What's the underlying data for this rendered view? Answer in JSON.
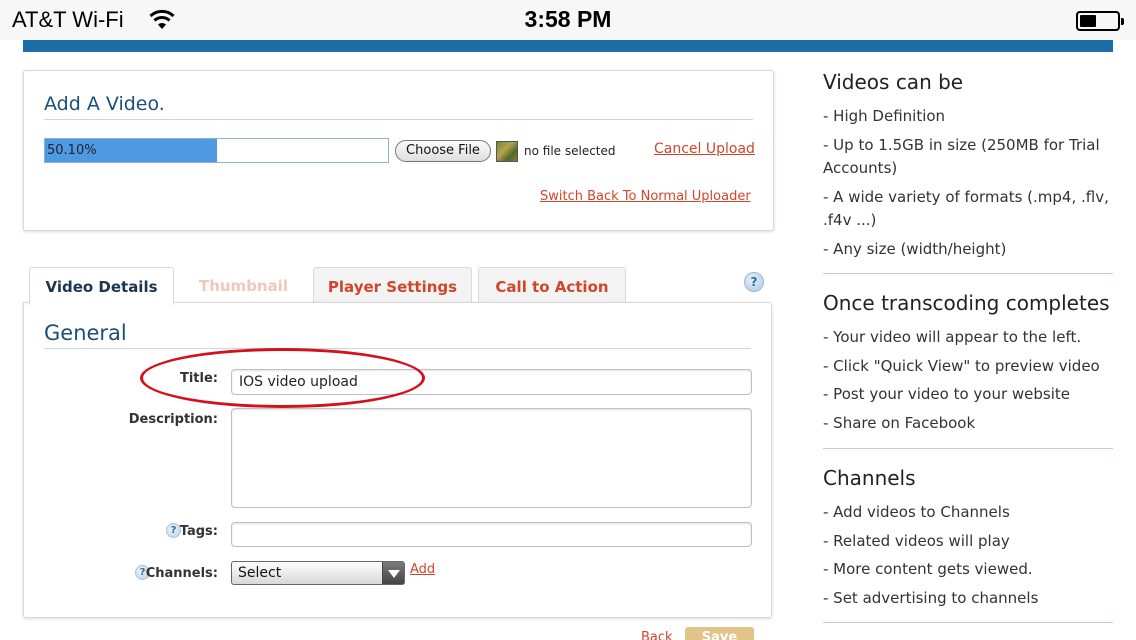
{
  "status_bar": {
    "carrier": "AT&T Wi-Fi",
    "time": "3:58 PM"
  },
  "upload": {
    "title": "Add A Video.",
    "progress": 0.501,
    "progress_text": "50.10%",
    "choose_file_label": "Choose File",
    "file_status": "no file selected",
    "cancel_label": "Cancel Upload",
    "switch_label": "Switch Back To Normal Uploader"
  },
  "tabs": {
    "active": "Video Details",
    "items": [
      {
        "label": "Video Details"
      },
      {
        "label": "Thumbnail"
      },
      {
        "label": "Player Settings"
      },
      {
        "label": "Call to Action"
      }
    ],
    "help": "?"
  },
  "details": {
    "section_title": "General",
    "title_label": "Title:",
    "title_value": "IOS video upload",
    "description_label": "Description:",
    "description_value": "",
    "tags_label": "Tags:",
    "tags_value": "",
    "channels_label": "Channels:",
    "channels_selected": "Select",
    "add_label": "Add",
    "help": "?"
  },
  "footer": {
    "back_label": "Back",
    "save_label": "Save"
  },
  "sidebar": {
    "sections": [
      {
        "heading": "Videos can be",
        "items": [
          "- High Definition",
          "- Up to 1.5GB in size (250MB for Trial Accounts)",
          "- A wide variety of formats (.mp4, .flv, .f4v ...)",
          "- Any size (width/height)"
        ]
      },
      {
        "heading": "Once transcoding completes",
        "items": [
          "- Your video will appear to the left.",
          "- Click \"Quick View\" to preview video",
          "- Post your video to your website",
          "- Share on Facebook"
        ]
      },
      {
        "heading": "Channels",
        "items": [
          "- Add videos to Channels",
          "- Related videos will play",
          "- More content gets viewed.",
          "- Set advertising to channels"
        ]
      }
    ]
  },
  "colors": {
    "accent_blue": "#1d6ea6",
    "link_orange": "#d0462a",
    "progress_fill": "#4e9ae0",
    "annotation_red": "#d4101a"
  }
}
